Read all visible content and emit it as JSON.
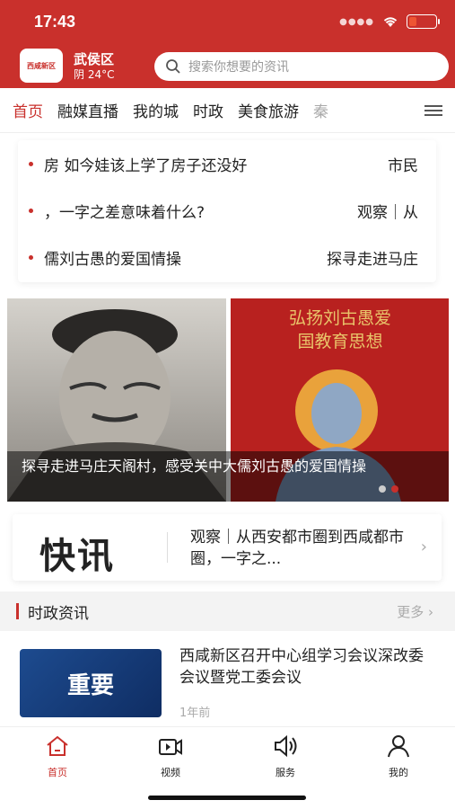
{
  "status": {
    "time": "17:43"
  },
  "header": {
    "logo_text": "西咸新区",
    "district": "武侯区",
    "weather": "阴 24°C",
    "search_placeholder": "搜索你想要的资讯"
  },
  "tabs": [
    {
      "label": "首页"
    },
    {
      "label": "融媒直播"
    },
    {
      "label": "我的城"
    },
    {
      "label": "时政"
    },
    {
      "label": "美食旅游"
    },
    {
      "label": "秦"
    }
  ],
  "headlines": [
    {
      "text": "房 如今娃该上学了房子还没好",
      "right": "市民"
    },
    {
      "text": "，一字之差意味着什么?",
      "right": "观察｜从"
    },
    {
      "text": "儒刘古愚的爱国情操",
      "right": "探寻走进马庄"
    }
  ],
  "banner": {
    "caption": "探寻走进马庄天阁村，感受关中大儒刘古愚的爱国情操",
    "slogan_line1": "弘扬刘古愚爱",
    "slogan_line2": "国教育思想"
  },
  "flash": {
    "logo": "快讯",
    "text": "观察｜从西安都市圈到西咸都市圈，一字之..."
  },
  "section": {
    "title": "时政资讯",
    "more": "更多"
  },
  "article": {
    "thumb_text": "重要",
    "title": "西咸新区召开中心组学习会议深改委会议暨党工委会议",
    "time": "1年前"
  },
  "bottom_nav": [
    {
      "label": "首页"
    },
    {
      "label": "视频"
    },
    {
      "label": "服务"
    },
    {
      "label": "我的"
    }
  ],
  "colors": {
    "brand": "#c9302c"
  }
}
